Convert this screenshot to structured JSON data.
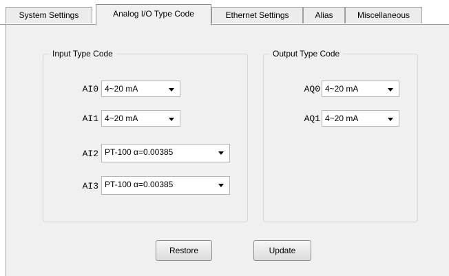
{
  "tabs": [
    {
      "label": "System Settings"
    },
    {
      "label": "Analog I/O Type Code"
    },
    {
      "label": "Ethernet Settings"
    },
    {
      "label": "Alias"
    },
    {
      "label": "Miscellaneous"
    }
  ],
  "active_tab": "Analog I/O Type Code",
  "input_group": {
    "title": "Input Type Code",
    "channels": [
      {
        "label": "AI0",
        "value": "4~20 mA"
      },
      {
        "label": "AI1",
        "value": "4~20 mA"
      },
      {
        "label": "AI2",
        "value": "PT-100 α=0.00385"
      },
      {
        "label": "AI3",
        "value": "PT-100 α=0.00385"
      }
    ]
  },
  "output_group": {
    "title": "Output Type Code",
    "channels": [
      {
        "label": "AQ0",
        "value": "4~20 mA"
      },
      {
        "label": "AQ1",
        "value": "4~20 mA"
      }
    ]
  },
  "buttons": {
    "restore": "Restore",
    "update": "Update"
  },
  "icons": {
    "dropdown": "chevron-down-icon"
  }
}
